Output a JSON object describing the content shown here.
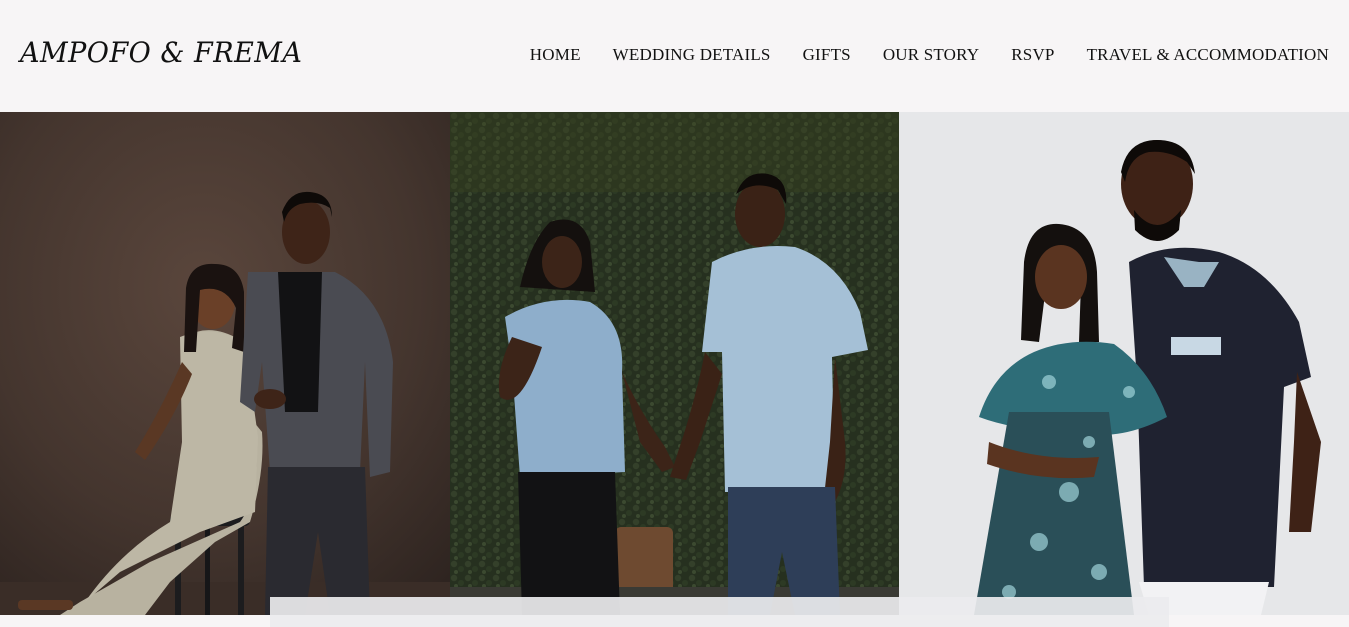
{
  "header": {
    "logo": "AMPOFO & FREMA",
    "nav": [
      {
        "label": "HOME"
      },
      {
        "label": "WEDDING DETAILS"
      },
      {
        "label": "GIFTS"
      },
      {
        "label": "OUR STORY"
      },
      {
        "label": "RSVP"
      },
      {
        "label": "TRAVEL & ACCOMMODATION"
      }
    ]
  },
  "gallery": {
    "photos": [
      {
        "name": "couple-studio-photo"
      },
      {
        "name": "couple-garden-photo"
      },
      {
        "name": "couple-embrace-photo"
      }
    ]
  },
  "colors": {
    "background": "#f7f5f6",
    "text": "#111111",
    "photo1_backdrop": "#4a3a33",
    "photo2_backdrop": "#2a3529",
    "photo3_backdrop": "#e6e7e9"
  }
}
